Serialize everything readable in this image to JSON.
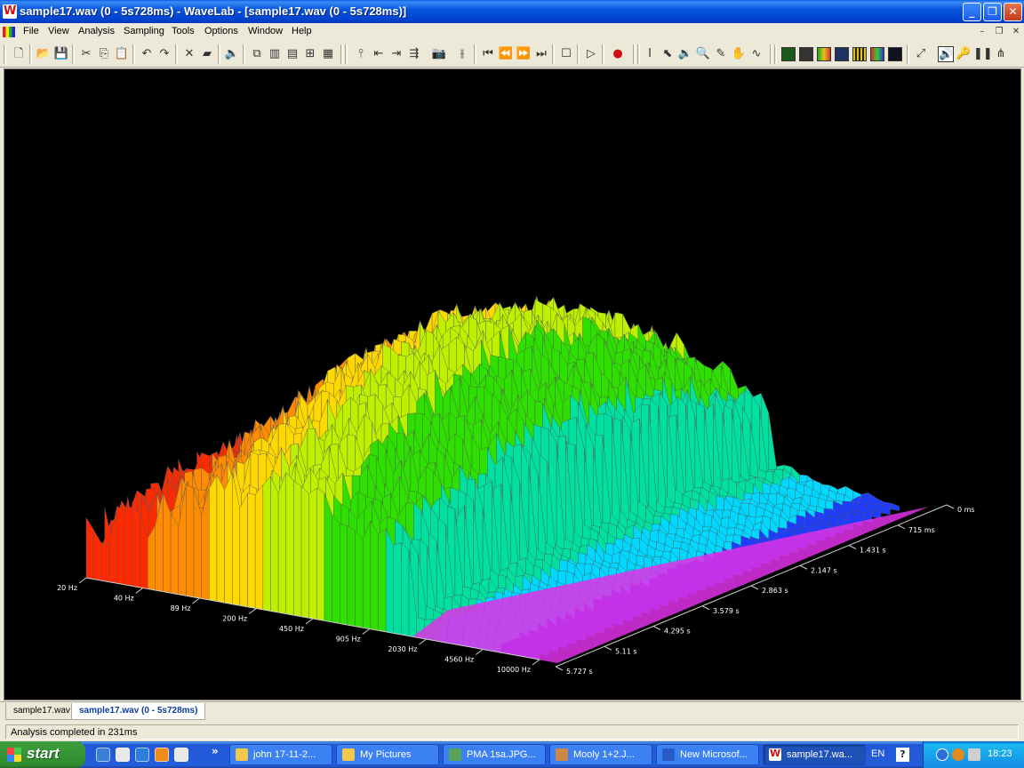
{
  "window": {
    "title": "sample17.wav (0 - 5s728ms) - WaveLab - [sample17.wav (0 - 5s728ms)]",
    "app_icon_letter": "W",
    "min_glyph": "_",
    "max_glyph": "❐",
    "close_glyph": "✕"
  },
  "menu": {
    "items": [
      "File",
      "View",
      "Analysis",
      "Sampling",
      "Tools",
      "Options",
      "Window",
      "Help"
    ],
    "mdi_min": "–",
    "mdi_restore": "❐",
    "mdi_close": "✕"
  },
  "toolbar": {
    "icons": [
      "new-file-icon",
      "open-folder-icon",
      "save-icon",
      "cut-icon",
      "copy-icon",
      "paste-icon",
      "undo-icon",
      "redo-icon",
      "delete-icon",
      "eraser-icon",
      "speaker-icon",
      "tile-cascade-icon",
      "tile-vertical-icon",
      "tile-horizontal-icon",
      "arrange-icon",
      "grid-icon",
      "marker-icon",
      "marker-prev-icon",
      "marker-next-icon",
      "marker-all-icon",
      "snapshot-icon",
      "split-icon",
      "go-start-icon",
      "rewind-icon",
      "fast-forward-icon",
      "go-end-icon",
      "stop-icon",
      "play-icon",
      "record-icon",
      "text-cursor-icon",
      "select-icon",
      "speaker-tool-icon",
      "zoom-tool-icon",
      "pencil-icon",
      "hand-icon",
      "curve-icon",
      "level-meter-icon",
      "phase-scope-icon",
      "spectroscope-icon",
      "wavescope-icon",
      "bit-meter-icon",
      "spectrum-icon",
      "oscilloscope-icon",
      "fullscreen-icon",
      "monitor-speaker-icon",
      "key-icon",
      "pause-icon",
      "waveform-icon"
    ],
    "accent_colors": {
      "meter_green": "#1fa81f",
      "meter_yellow": "#e3c31b",
      "record_red": "#d01010"
    }
  },
  "chart_data": {
    "type": "3d-spectrum",
    "title": "",
    "frequency_axis_label": "",
    "time_axis_label": "",
    "frequency_ticks": [
      "20 Hz",
      "40 Hz",
      "89 Hz",
      "200 Hz",
      "450 Hz",
      "905 Hz",
      "2030 Hz",
      "4560 Hz",
      "10000 Hz"
    ],
    "time_ticks": [
      "0 ms",
      "715 ms",
      "1.431 s",
      "2.147 s",
      "2.863 s",
      "3.579 s",
      "4.295 s",
      "5.11 s",
      "5.727 s"
    ],
    "frequency_range": [
      "20 Hz",
      "10000 Hz"
    ],
    "time_range": [
      "0 ms",
      "5.727 s"
    ],
    "color_scale": [
      "#ff2a00",
      "#ff8c00",
      "#ffd800",
      "#bff000",
      "#2ee000",
      "#00e0a0",
      "#00d8ff",
      "#1e3cff",
      "#2a10f0",
      "#e030e8"
    ],
    "background": "#000000",
    "notes": "Front (high-frequency, late-time) floor is magenta; low frequencies on left render red/orange/yellow; mid frequencies green/cyan; high frequencies blue."
  },
  "tabs": [
    {
      "label": "sample17.wav",
      "active": false
    },
    {
      "label": "sample17.wav (0 - 5s728ms)",
      "active": true
    }
  ],
  "status": {
    "text": "Analysis completed in 231ms"
  },
  "taskbar": {
    "start_label": "start",
    "tasks": [
      {
        "label": "john 17-11-2...",
        "icon": "folder-icon",
        "color": "#f1c84a",
        "active": false
      },
      {
        "label": "My Pictures",
        "icon": "pictures-icon",
        "color": "#f1c84a",
        "active": false
      },
      {
        "label": "PMA 1sa.JPG...",
        "icon": "image-viewer-icon",
        "color": "#5aa35a",
        "active": false
      },
      {
        "label": "Mooly 1+2.J...",
        "icon": "paint-icon",
        "color": "#cc8844",
        "active": false
      },
      {
        "label": "New Microsof...",
        "icon": "word-icon",
        "color": "#2a5cc8",
        "active": false
      },
      {
        "label": "sample17.wa...",
        "icon": "wavelab-icon",
        "color": "#d21010",
        "active": true
      }
    ],
    "overflow_glyph": "»",
    "language": "EN",
    "help_glyph": "?",
    "clock": "18:23"
  }
}
